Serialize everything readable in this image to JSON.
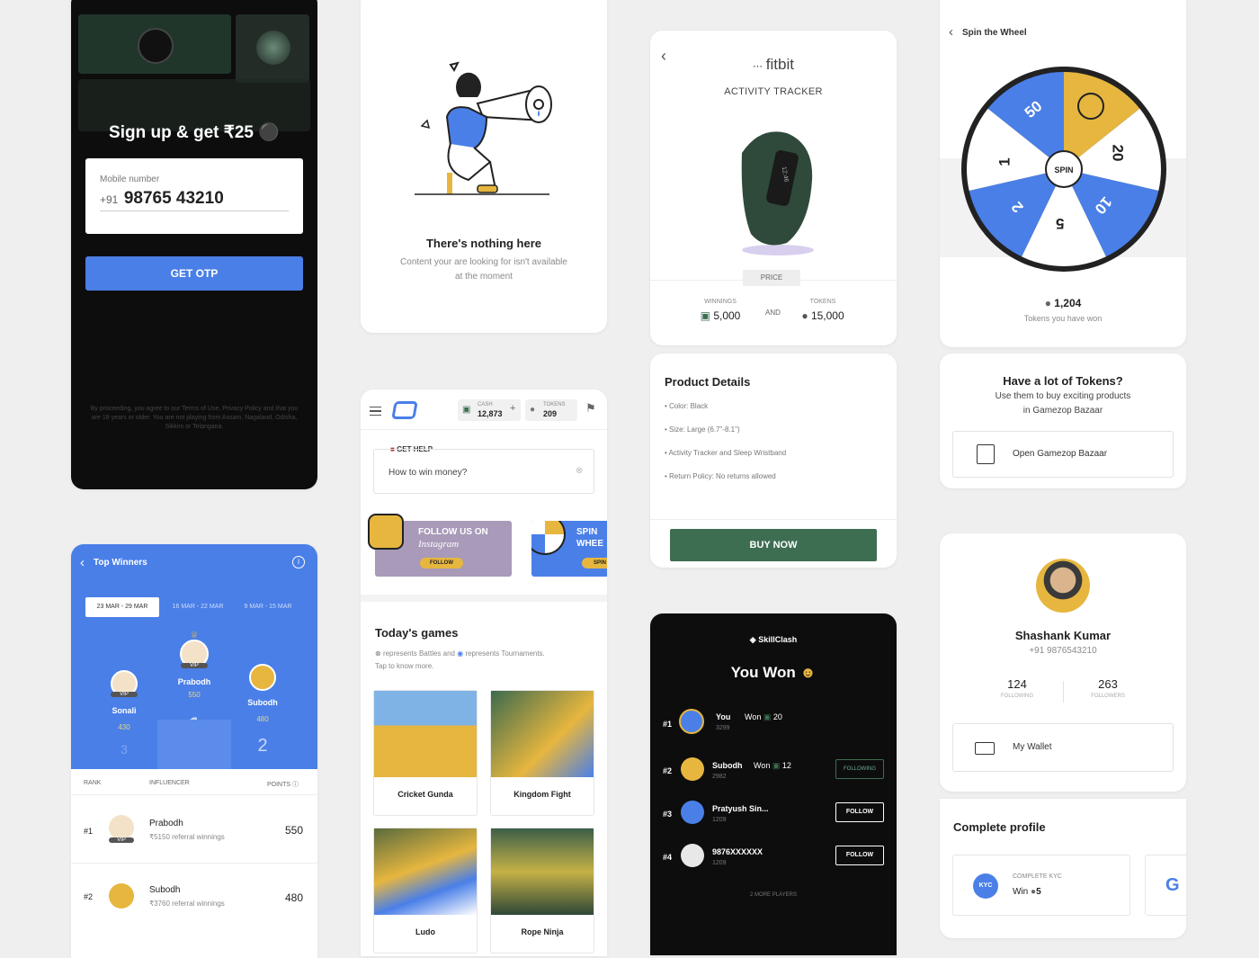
{
  "signup": {
    "headline": "Sign up & get ₹25",
    "mobile_label": "Mobile number",
    "country_code": "+91",
    "mobile_value": "98765 43210",
    "otp_button": "GET OTP",
    "terms": "By proceeding, you agree to our Terms of Use, Privacy Policy and that you are 18 years or older. You are not playing from Assam, Nagaland, Odisha, Sikkim or Telangana."
  },
  "empty": {
    "title": "There's nothing here",
    "line1": "Content your are looking for isn't available",
    "line2": "at the moment"
  },
  "fitbit": {
    "brand": "fitbit",
    "category": "ACTIVITY TRACKER",
    "price_label": "PRICE",
    "winnings_label": "WINNINGS",
    "winnings_value": "5,000",
    "and_label": "AND",
    "tokens_label": "TOKENS",
    "tokens_value": "15,000",
    "details_title": "Product Details",
    "details": [
      "Color: Black",
      "Size: Large (6.7\"-8.1\")",
      "Activity Tracker and Sleep Wristband",
      "Return Policy: No returns allowed"
    ],
    "buy_button": "BUY NOW",
    "accent": "#3e6e52"
  },
  "spin": {
    "title": "Spin the Wheel",
    "spin_label": "SPIN",
    "segments": [
      "50",
      "",
      "20",
      "10",
      "5",
      "2",
      "1"
    ],
    "tokens_value": "1,204",
    "tokens_caption": "Tokens you have won",
    "promo_title": "Have a lot of Tokens?",
    "promo_line1": "Use them to buy exciting products",
    "promo_line2": "in Gamezop Bazaar",
    "bazaar_button": "Open Gamezop Bazaar"
  },
  "home": {
    "cash_label": "CASH",
    "cash_value": "12,873",
    "tokens_label": "TOKENS",
    "tokens_value": "209",
    "help_label": "GET HELP",
    "help_question": "How to win money?",
    "banner1_title": "FOLLOW US ON",
    "banner1_sub": "Instagram",
    "banner1_btn": "FOLLOW",
    "banner2_title": "SPIN",
    "banner2_sub": "WHEE",
    "banner2_btn": "SPIN",
    "games_title": "Today's games",
    "legend_a": "represents Battles and",
    "legend_b": "represents Tournaments.",
    "legend_c": "Tap to know more.",
    "games": [
      "Cricket Gunda",
      "Kingdom Fight",
      "Ludo",
      "Rope Ninja"
    ]
  },
  "winners": {
    "title": "Top Winners",
    "tabs": [
      "23 MAR - 29 MAR",
      "16 MAR - 22 MAR",
      "9 MAR - 15 MAR"
    ],
    "podium": [
      {
        "name": "Sonali",
        "points": "430",
        "rank": "3",
        "badge": "VIP"
      },
      {
        "name": "Prabodh",
        "points": "550",
        "rank": "1",
        "badge": "VIP"
      },
      {
        "name": "Subodh",
        "points": "480",
        "rank": "2",
        "badge": ""
      }
    ],
    "col_rank": "RANK",
    "col_influencer": "INFLUENCER",
    "col_points": "POINTS",
    "rows": [
      {
        "rank": "#1",
        "name": "Prabodh",
        "sub": "₹5150 referral winnings",
        "points": "550",
        "badge": "VIP"
      },
      {
        "rank": "#2",
        "name": "Subodh",
        "sub": "₹3760 referral winnings",
        "points": "480",
        "badge": ""
      }
    ]
  },
  "skillclash": {
    "brand": "SkillClash",
    "headline": "You Won",
    "players": [
      {
        "rank": "#1",
        "name": "You",
        "won_label": "Won",
        "won": "20",
        "score": "3299",
        "action": ""
      },
      {
        "rank": "#2",
        "name": "Subodh",
        "won_label": "Won",
        "won": "12",
        "score": "2982",
        "action": "FOLLOWING"
      },
      {
        "rank": "#3",
        "name": "Pratyush Sin...",
        "won_label": "",
        "won": "",
        "score": "1209",
        "action": "FOLLOW"
      },
      {
        "rank": "#4",
        "name": "9876XXXXXX",
        "won_label": "",
        "won": "",
        "score": "1209",
        "action": "FOLLOW"
      }
    ],
    "more_players": "2 MORE PLAYERS"
  },
  "profile": {
    "name": "Shashank Kumar",
    "phone": "+91 9876543210",
    "following_value": "124",
    "following_label": "FOLLOWING",
    "followers_value": "263",
    "followers_label": "FOLLOWERS",
    "wallet": "My Wallet",
    "complete_title": "Complete profile",
    "kyc_badge": "KYC",
    "kyc_label": "COMPLETE KYC",
    "kyc_reward_prefix": "Win",
    "kyc_reward": "5"
  },
  "colors": {
    "blue": "#4a7fe8",
    "gold": "#e6b63f",
    "green": "#3e6e52"
  }
}
